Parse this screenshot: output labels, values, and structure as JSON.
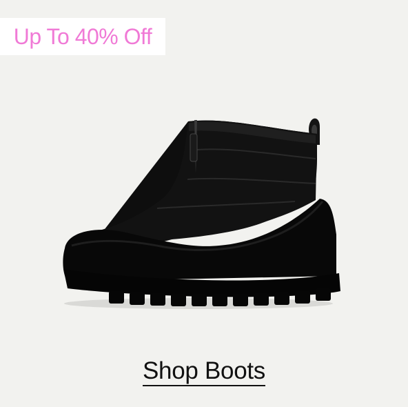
{
  "promo": {
    "label": "Up To 40% Off",
    "color": "#f07ad6"
  },
  "product": {
    "image_icon": "black-zip-boot"
  },
  "cta": {
    "label": "Shop Boots"
  }
}
